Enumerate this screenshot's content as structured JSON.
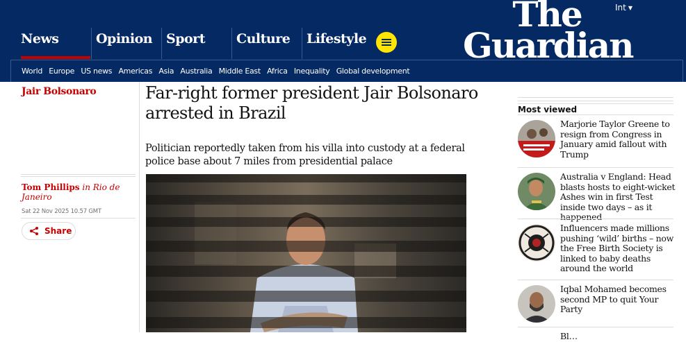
{
  "header": {
    "edition": "Int",
    "logo_line1": "The",
    "logo_line2": "Guardian",
    "pillars": [
      {
        "label": "News"
      },
      {
        "label": "Opinion"
      },
      {
        "label": "Sport"
      },
      {
        "label": "Culture"
      },
      {
        "label": "Lifestyle"
      }
    ],
    "subnav": [
      "World",
      "Europe",
      "US news",
      "Americas",
      "Asia",
      "Australia",
      "Middle East",
      "Africa",
      "Inequality",
      "Global development"
    ]
  },
  "article": {
    "section": "Jair Bolsonaro",
    "headline": "Far-right former president Jair Bolsonaro arrested in Brazil",
    "standfirst": "Politician reportedly taken from his villa into custody at a federal police base about 7 miles from presidential palace",
    "author": "Tom Phillips",
    "location": " in Rio de Janeiro",
    "date": "Sat 22 Nov 2025 10.57 GMT",
    "share_label": "Share"
  },
  "most_viewed": {
    "title": "Most viewed",
    "items": [
      {
        "text": "Marjorie Taylor Greene to resign from Congress in January amid fallout with Trump"
      },
      {
        "text": "Australia v England: Head blasts hosts to eight-wicket Ashes win in first Test inside two days – as it happened"
      },
      {
        "text": "Influencers made millions pushing ‘wild’ births – now the Free Birth Society is linked to baby deaths around the world"
      },
      {
        "text": "Iqbal Mohamed becomes second MP to quit Your Party"
      },
      {
        "text": "Bl…"
      }
    ]
  },
  "colors": {
    "brand": "#052962",
    "news_accent": "#c70000",
    "menu_button": "#ffe500"
  }
}
